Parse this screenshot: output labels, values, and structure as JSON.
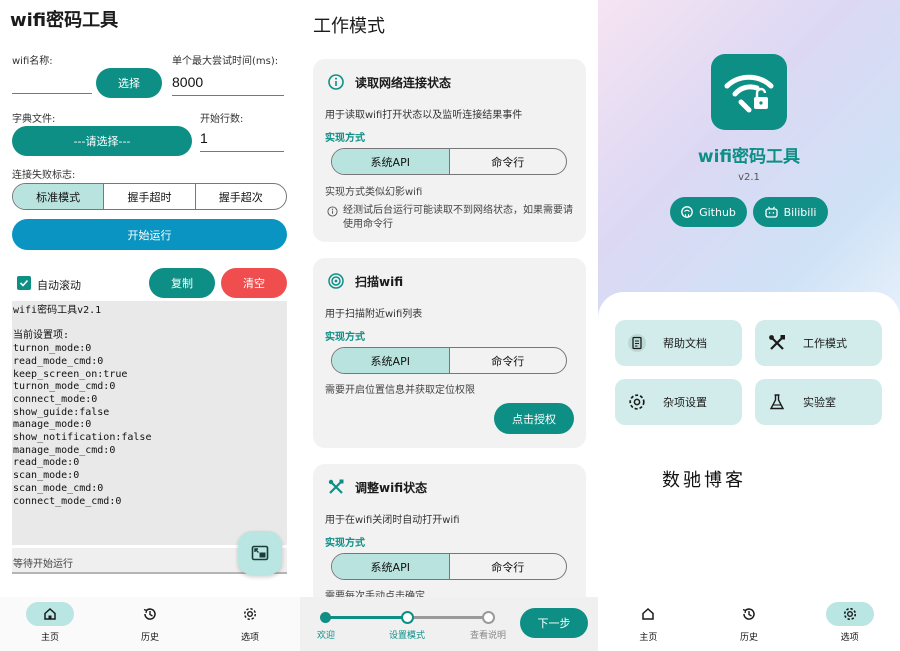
{
  "screen1": {
    "title": "wifi密码工具",
    "wifi_name_label": "wifi名称:",
    "wifi_name_value": "",
    "select_button": "选择",
    "max_time_label": "单个最大尝试时间(ms):",
    "max_time_value": "8000",
    "dict_label": "字典文件:",
    "dict_button": "---请选择---",
    "start_line_label": "开始行数:",
    "start_line_value": "1",
    "fail_flag_label": "连接失败标志:",
    "fail_modes": [
      "标准模式",
      "握手超时",
      "握手超次"
    ],
    "fail_mode_selected": 0,
    "run_button": "开始运行",
    "auto_scroll_label": "自动滚动",
    "auto_scroll_checked": true,
    "copy_button": "复制",
    "clear_button": "清空",
    "log_lines": [
      "wifi密码工具v2.1",
      "",
      "当前设置项:",
      "turnon_mode:0",
      "read_mode_cmd:0",
      "keep_screen_on:true",
      "turnon_mode_cmd:0",
      "connect_mode:0",
      "show_guide:false",
      "manage_mode:0",
      "show_notification:false",
      "manage_mode_cmd:0",
      "read_mode:0",
      "scan_mode:0",
      "scan_mode_cmd:0",
      "connect_mode_cmd:0"
    ],
    "status_text": "等待开始运行",
    "nav": [
      {
        "label": "主页",
        "icon": "home-icon",
        "active": true
      },
      {
        "label": "历史",
        "icon": "history-icon",
        "active": false
      },
      {
        "label": "选项",
        "icon": "settings-icon",
        "active": false
      }
    ]
  },
  "screen2": {
    "title": "工作模式",
    "cards": [
      {
        "title": "读取网络连接状态",
        "icon": "info-icon",
        "desc": "用于读取wifi打开状态以及监听连接结果事件",
        "impl_label": "实现方式",
        "options": [
          "系统API",
          "命令行"
        ],
        "selected": 0,
        "note": "实现方式类似幻影wifi",
        "warning": "经测试后台运行可能读取不到网络状态，如果需要请使用命令行"
      },
      {
        "title": "扫描wifi",
        "icon": "scan-icon",
        "desc": "用于扫描附近wifi列表",
        "impl_label": "实现方式",
        "options": [
          "系统API",
          "命令行"
        ],
        "selected": 0,
        "note": "需要开启位置信息并获取定位权限",
        "action_button": "点击授权"
      },
      {
        "title": "调整wifi状态",
        "icon": "tools-icon",
        "desc": "用于在wifi关闭时自动打开wifi",
        "impl_label": "实现方式",
        "options": [
          "系统API",
          "命令行"
        ],
        "selected": 0,
        "note": "需要每次手动点击确定"
      }
    ],
    "steps": [
      "欢迎",
      "设置模式",
      "查看说明"
    ],
    "current_step": 1,
    "next_button": "下一步"
  },
  "screen3": {
    "app_name": "wifi密码工具",
    "version": "v2.1",
    "github_button": "Github",
    "bilibili_button": "Bilibili",
    "tiles": [
      {
        "label": "帮助文档",
        "icon": "document-icon"
      },
      {
        "label": "工作模式",
        "icon": "tools-icon"
      },
      {
        "label": "杂项设置",
        "icon": "gear-icon"
      },
      {
        "label": "实验室",
        "icon": "flask-icon"
      }
    ],
    "watermark": "数驰博客",
    "nav": [
      {
        "label": "主页",
        "icon": "home-icon",
        "active": false
      },
      {
        "label": "历史",
        "icon": "history-icon",
        "active": false
      },
      {
        "label": "选项",
        "icon": "settings-icon",
        "active": true
      }
    ]
  },
  "colors": {
    "primary": "#0e8f86",
    "primary_light": "#b9e6e2",
    "clear_red": "#f04e4e",
    "card_bg": "#f2f2f2",
    "log_bg": "#e9e9e9"
  }
}
